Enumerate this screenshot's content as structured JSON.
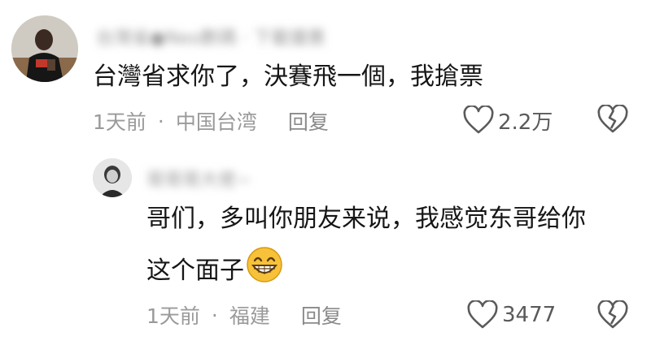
{
  "comment": {
    "username": "台灣省●Neo數碼 · 下載優惠",
    "text": "台灣省求你了，決賽飛一個，我搶票",
    "time": "1天前",
    "separator": "·",
    "location": "中国台湾",
    "reply_label": "回复",
    "like_count": "2.2万"
  },
  "reply": {
    "username": "哥哥哥大佬~",
    "text_line1": "哥们，多叫你朋友来说，我感觉东哥给你",
    "text_line2": "这个面子",
    "emoji": "grin-emoji",
    "time": "1天前",
    "separator": "·",
    "location": "福建",
    "reply_label": "回复",
    "like_count": "3477"
  },
  "icons": {
    "like": "heart-outline-icon",
    "dislike": "broken-heart-icon"
  },
  "colors": {
    "text": "#161616",
    "meta": "#9a9a9a",
    "icon": "#5a5a5a",
    "emoji_face": "#f7c23a"
  }
}
